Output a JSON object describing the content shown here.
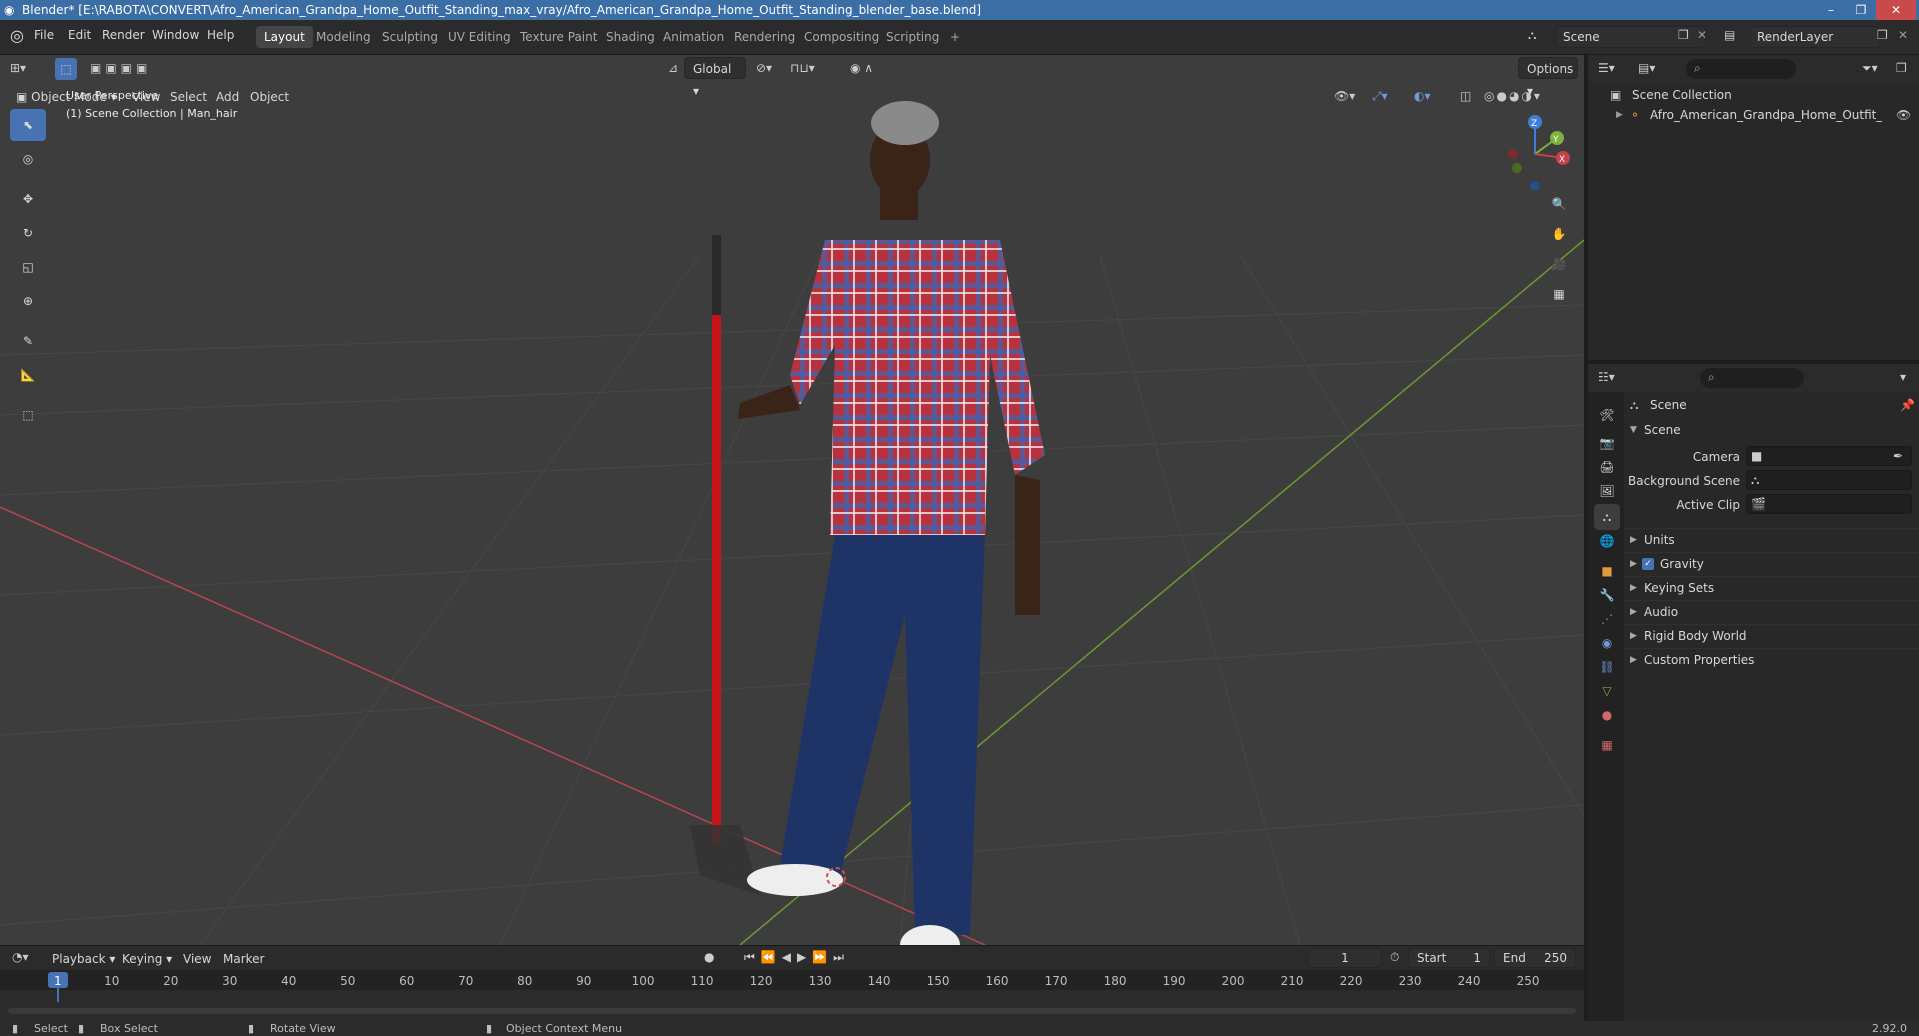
{
  "window": {
    "title": "Blender* [E:\\RABOTA\\CONVERT\\Afro_American_Grandpa_Home_Outfit_Standing_max_vray/Afro_American_Grandpa_Home_Outfit_Standing_blender_base.blend]"
  },
  "menu": [
    "File",
    "Edit",
    "Render",
    "Window",
    "Help"
  ],
  "workspaces": [
    "Layout",
    "Modeling",
    "Sculpting",
    "UV Editing",
    "Texture Paint",
    "Shading",
    "Animation",
    "Rendering",
    "Compositing",
    "Scripting",
    "+"
  ],
  "scene_selector": {
    "value": "Scene"
  },
  "renderlayer_selector": {
    "value": "RenderLayer"
  },
  "viewport": {
    "mode": "Object Mode",
    "menus": [
      "View",
      "Select",
      "Add",
      "Object"
    ],
    "orientation": "Global",
    "options_label": "Options",
    "overlay_line1": "User Perspective",
    "overlay_line2": "(1) Scene Collection | Man_hair",
    "gizmo_axes": {
      "z": "Z",
      "y": "Y",
      "x": "X"
    }
  },
  "outliner": {
    "root": "Scene Collection",
    "items": [
      {
        "label": "Afro_American_Grandpa_Home_Outfit_Stanc"
      }
    ]
  },
  "properties": {
    "context": "Scene",
    "panel_scene": "Scene",
    "camera_label": "Camera",
    "bg_scene_label": "Background Scene",
    "active_clip_label": "Active Clip",
    "panels": [
      "Units",
      "Gravity",
      "Keying Sets",
      "Audio",
      "Rigid Body World",
      "Custom Properties"
    ],
    "gravity_checked": true
  },
  "timeline": {
    "menus": [
      "Playback",
      "Keying",
      "View",
      "Marker"
    ],
    "current_frame": "1",
    "start_label": "Start",
    "start_value": "1",
    "end_label": "End",
    "end_value": "250",
    "ruler": [
      "1",
      "10",
      "20",
      "30",
      "40",
      "50",
      "60",
      "70",
      "80",
      "90",
      "100",
      "110",
      "120",
      "130",
      "140",
      "150",
      "160",
      "170",
      "180",
      "190",
      "200",
      "210",
      "220",
      "230",
      "240",
      "250"
    ]
  },
  "statusbar": {
    "select": "Select",
    "box_select": "Box Select",
    "rotate_view": "Rotate View",
    "context_menu": "Object Context Menu",
    "version": "2.92.0"
  },
  "colors": {
    "accent": "#4772b3",
    "titlebar": "#3a6ea5",
    "x_axis": "#c8404c",
    "y_axis": "#7db33c",
    "z_axis": "#3b7fd8"
  }
}
